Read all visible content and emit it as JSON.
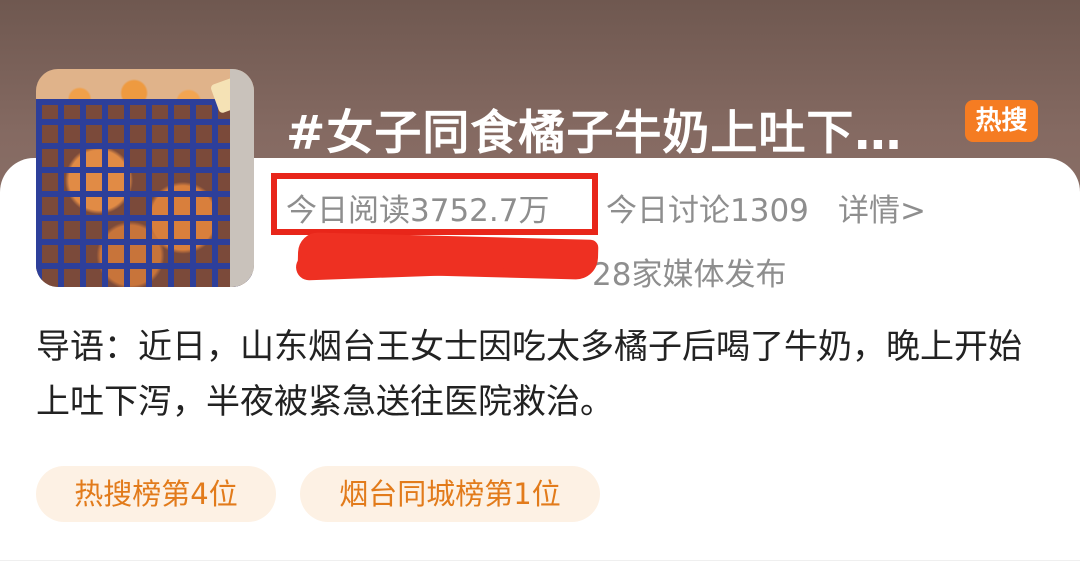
{
  "topic": {
    "title": "#女子同食橘子牛奶上吐下…",
    "hot_badge": "热搜",
    "thumbnail": "oranges-in-blue-crate-photo"
  },
  "stats": {
    "today_read": "今日阅读3752.7万",
    "today_discuss": "今日讨论1309",
    "detail_link": "详情>",
    "media": "28家媒体发布"
  },
  "intro": {
    "text": "导语：近日，山东烟台王女士因吃太多橘子后喝了牛奶，晚上开始上吐下泻，半夜被紧急送往医院救治。"
  },
  "tags": [
    {
      "label": "热搜榜第4位"
    },
    {
      "label": "烟台同城榜第1位"
    }
  ],
  "colors": {
    "header_bg": "#856a62",
    "accent_orange": "#f57c22",
    "highlight_red": "#e8261a",
    "tag_bg": "#fdf1e4",
    "tag_text": "#e27b1b"
  }
}
